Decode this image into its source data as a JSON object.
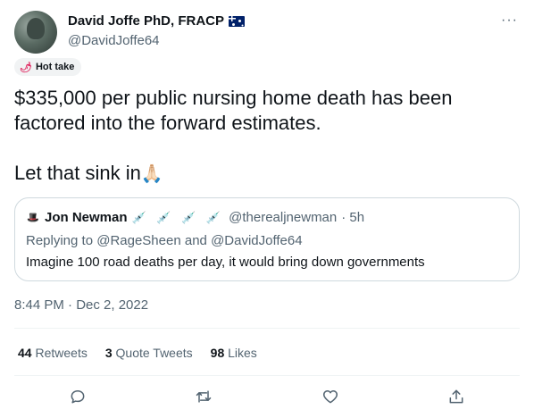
{
  "author": {
    "display_name": "David Joffe PhD, FRACP",
    "handle": "@DavidJoffe64",
    "flag_icon": "australia-flag-icon"
  },
  "badge": {
    "label": "Hot take",
    "icon": "chili-pepper-icon"
  },
  "tweet": {
    "line1": "$335,000 per public nursing home death has been factored into the forward estimates.",
    "line2": "Let that sink in",
    "emoji": "🙏🏻"
  },
  "quoted_tweet": {
    "name": "Jon Newman",
    "emoji_icons": "💉 💉 💉 💉",
    "handle": "@therealjnewman",
    "time": "· 5h",
    "reply_prefix": "Replying to",
    "reply_to_1": "@RageSheen",
    "reply_and": "and",
    "reply_to_2": "@DavidJoffe64",
    "text": "Imagine 100 road deaths per day, it would bring down governments"
  },
  "timestamp": "8:44 PM · Dec 2, 2022",
  "stats": {
    "retweets_count": "44",
    "retweets_label": "Retweets",
    "quotes_count": "3",
    "quotes_label": "Quote Tweets",
    "likes_count": "98",
    "likes_label": "Likes"
  },
  "more_icon": "···",
  "colors": {
    "text_primary": "#0f1419",
    "text_secondary": "#536471",
    "border": "#cfd9de",
    "divider": "#eff3f4"
  }
}
